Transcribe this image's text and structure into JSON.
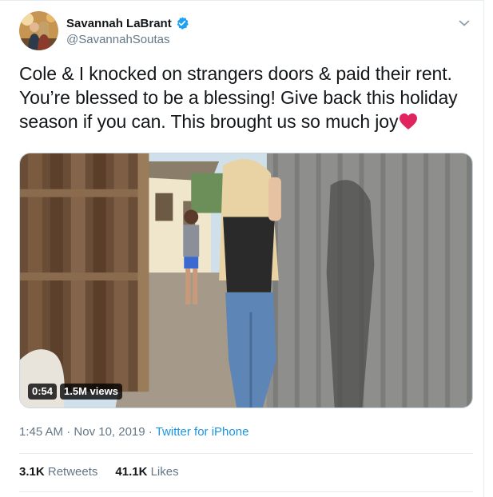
{
  "author": {
    "display_name": "Savannah LaBrant",
    "handle": "@SavannahSoutas",
    "verified": true,
    "avatar_icon": "avatar-photo"
  },
  "tweet": {
    "text_line1": "Cole & I knocked on strangers doors & paid their rent.",
    "text_line2": "You’re blessed to be a blessing! Give back this holiday",
    "text_line3": "season if you can. This brought us so much joy",
    "emoji_icon": "red-heart-icon"
  },
  "media": {
    "duration": "0:54",
    "views": "1.5M views"
  },
  "meta": {
    "time": "1:45 AM",
    "separator": "·",
    "date": "Nov 10, 2019",
    "source": "Twitter for iPhone"
  },
  "stats": {
    "retweets_count": "3.1K",
    "retweets_label": "Retweets",
    "likes_count": "41.1K",
    "likes_label": "Likes"
  },
  "colors": {
    "link_blue": "#1b95e0",
    "verified_blue": "#1da1f2",
    "secondary_text": "#657786",
    "heart_red": "#e0245e"
  }
}
